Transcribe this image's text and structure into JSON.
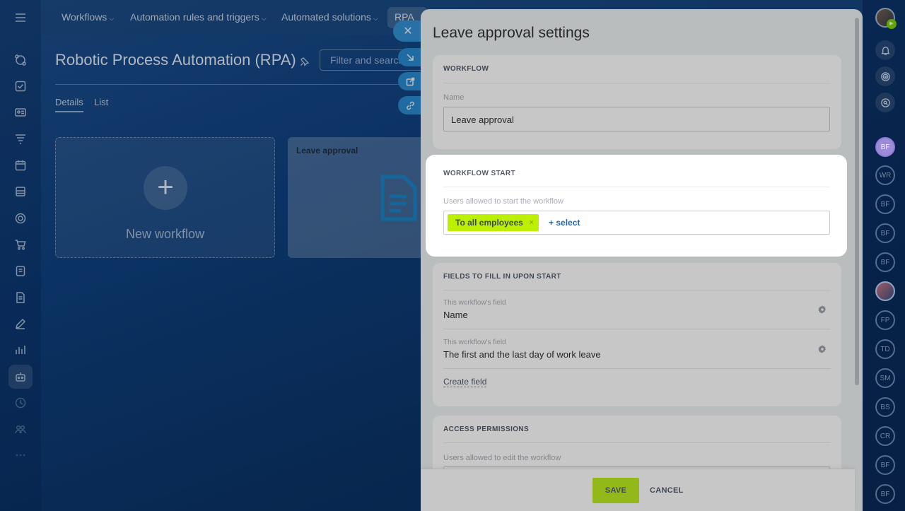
{
  "topnav": {
    "items": [
      "Workflows",
      "Automation rules and triggers",
      "Automated solutions"
    ],
    "active": "RPA"
  },
  "page": {
    "title": "Robotic Process Automation (RPA)",
    "filter_placeholder": "Filter and search",
    "tabs": [
      "Details",
      "List"
    ]
  },
  "cards": {
    "new_label": "New workflow",
    "workflow_title": "Leave approval"
  },
  "slider": {
    "title": "Leave approval settings",
    "workflow": {
      "heading": "WORKFLOW",
      "name_label": "Name",
      "name_value": "Leave approval"
    },
    "workflow_start": {
      "heading": "WORKFLOW START",
      "users_label": "Users allowed to start the workflow",
      "chip": "To all employees",
      "chip_remove": "×",
      "select_link": "+ select"
    },
    "fields": {
      "heading": "FIELDS TO FILL IN UPON START",
      "rows": [
        {
          "label": "This workflow's field",
          "value": "Name"
        },
        {
          "label": "This workflow's field",
          "value": "The first and the last day of work leave"
        }
      ],
      "create_link": "Create field"
    },
    "access": {
      "heading": "ACCESS PERMISSIONS",
      "edit_label": "Users allowed to edit the workflow"
    },
    "footer": {
      "save": "SAVE",
      "cancel": "CANCEL"
    }
  },
  "right_rail": {
    "users": [
      "BF",
      "WR",
      "BF",
      "BF",
      "BF",
      "",
      "FP",
      "TD",
      "SM",
      "BS",
      "CR",
      "BF",
      "BF"
    ]
  },
  "colors": {
    "accent_green": "#bbed21",
    "chip_green": "#bcef00",
    "link_blue": "#2067b0",
    "bg_blue": "#0f4180"
  }
}
